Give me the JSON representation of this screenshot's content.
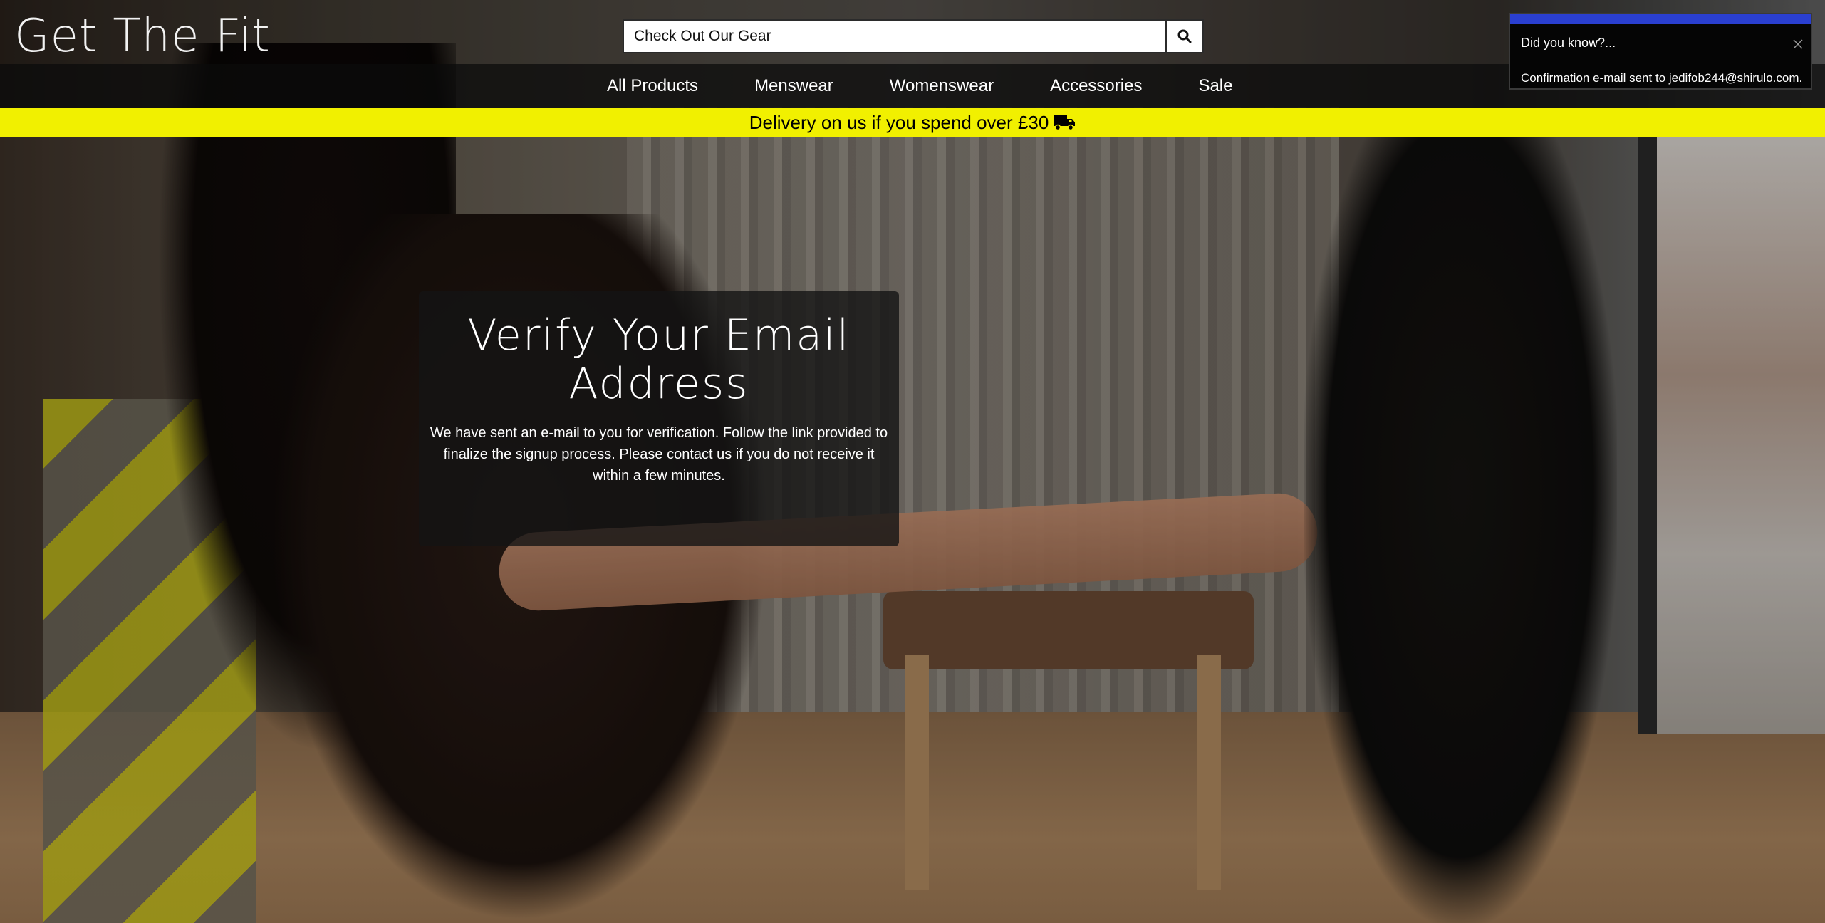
{
  "site": {
    "logo": "Get The Fit"
  },
  "search": {
    "value": "Check Out Our Gear",
    "button_icon": "search-icon"
  },
  "nav": {
    "items": [
      "All Products",
      "Menswear",
      "Womenswear",
      "Accessories",
      "Sale"
    ]
  },
  "banner": {
    "text": "Delivery on us if you spend over £30",
    "icon": "truck-icon"
  },
  "notification": {
    "title": "Did you know?...",
    "message": "Confirmation e-mail sent to jedifob244@shirulo.com.",
    "accent_color": "#2a3fd0"
  },
  "modal": {
    "title": "Verify Your Email Address",
    "body": "We have sent an e-mail to you for verification. Follow the link provided to finalize the signup process. Please contact us if you do not receive it within a few minutes."
  },
  "colors": {
    "banner": "#f1f000",
    "nav_bg": "#0a0a0a"
  }
}
